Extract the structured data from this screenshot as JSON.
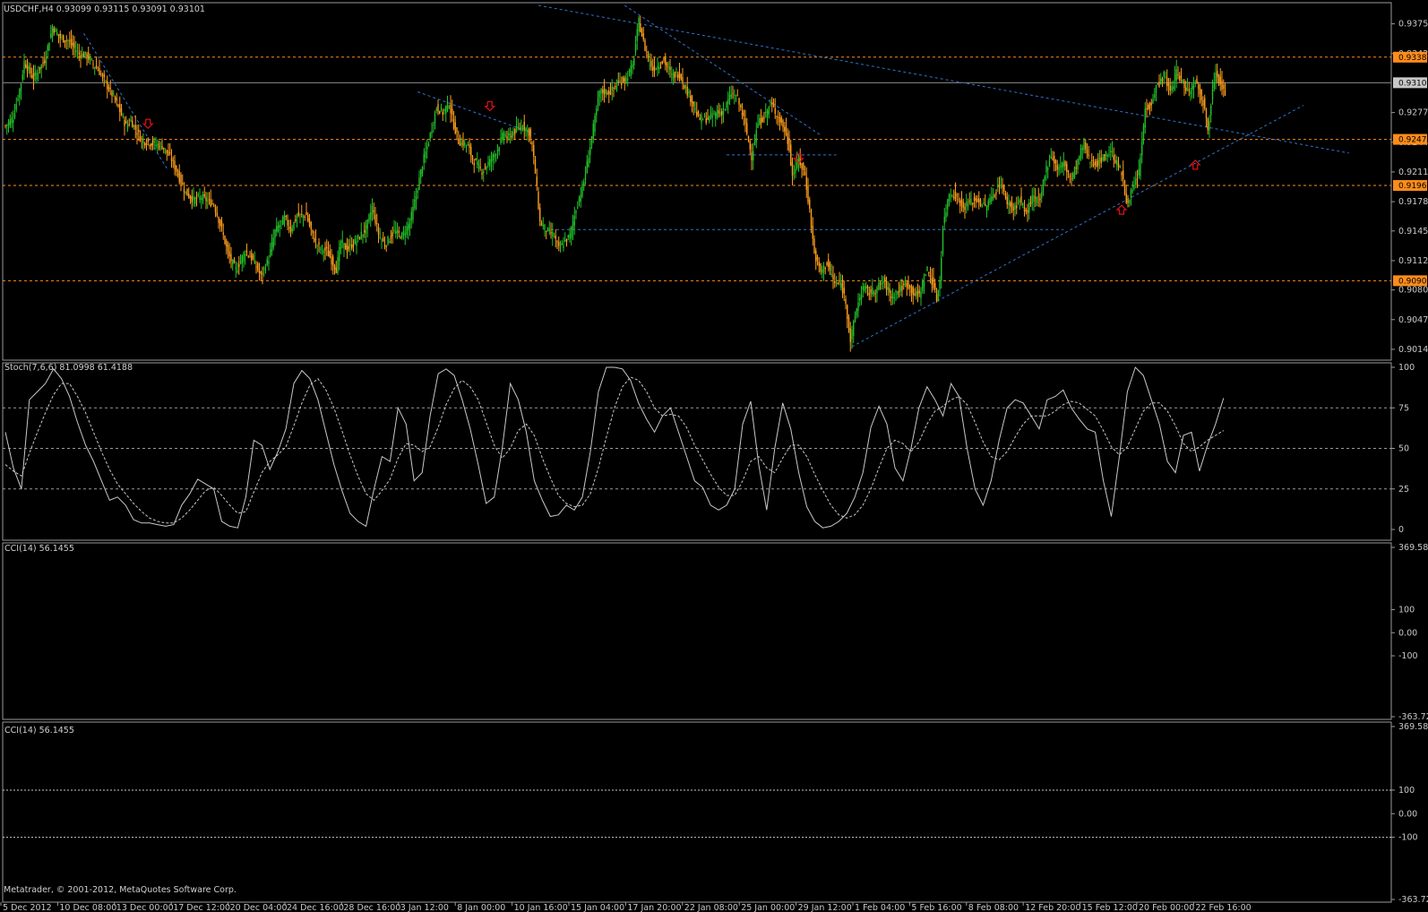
{
  "window": {
    "header": "USDCHF,H4  0.93099 0.93115 0.93091 0.93101",
    "copyright": "Metatrader, © 2001-2012, MetaQuotes Software Corp."
  },
  "colors": {
    "background": "#000000",
    "bull": "#22c22a",
    "bear": "#ff9e1c",
    "level_line": "#ff8c1a",
    "trendline": "#2f74d0",
    "arrow": "#e01010",
    "indicator": "#c8c8c8",
    "frame": "#9a9a9a"
  },
  "chart_data": [
    {
      "type": "candlestick",
      "title": "USDCHF,H4",
      "ohlc_header": [
        0.93099,
        0.93115,
        0.93091,
        0.93101
      ],
      "ylim": [
        0.9002,
        0.9399
      ],
      "y_tick_labels": [
        "0.93755",
        "0.93425",
        "0.92770",
        "0.92440",
        "0.92110",
        "0.91780",
        "0.91455",
        "0.91125",
        "0.90800",
        "0.90470",
        "0.90140"
      ],
      "y_ticks": [
        0.93755,
        0.93425,
        0.9277,
        0.9244,
        0.9211,
        0.9178,
        0.91455,
        0.91125,
        0.908,
        0.9047,
        0.9014
      ],
      "horizontal_levels": [
        {
          "label": "0.93385",
          "value": 0.93385
        },
        {
          "label": "0.92472",
          "value": 0.92472
        },
        {
          "label": "0.91960",
          "value": 0.9196
        },
        {
          "label": "0.90902",
          "value": 0.90902
        }
      ],
      "current_price": {
        "label": "0.93101",
        "value": 0.93101
      },
      "x_labels": [
        "5 Dec 2012",
        "10 Dec 08:00",
        "13 Dec 00:00",
        "17 Dec 12:00",
        "20 Dec 04:00",
        "24 Dec 16:00",
        "28 Dec 16:00",
        "3 Jan 12:00",
        "8 Jan 00:00",
        "10 Jan 16:00",
        "15 Jan 04:00",
        "17 Jan 20:00",
        "22 Jan 08:00",
        "25 Jan 00:00",
        "29 Jan 12:00",
        "1 Feb 04:00",
        "5 Feb 16:00",
        "8 Feb 08:00",
        "12 Feb 20:00",
        "15 Feb 12:00",
        "20 Feb 00:00",
        "22 Feb 16:00"
      ],
      "close_path": [
        [
          0,
          0.9262
        ],
        [
          5,
          0.9272
        ],
        [
          10,
          0.931
        ],
        [
          12,
          0.9333
        ],
        [
          18,
          0.9315
        ],
        [
          25,
          0.9335
        ],
        [
          30,
          0.9372
        ],
        [
          35,
          0.936
        ],
        [
          40,
          0.9357
        ],
        [
          47,
          0.9342
        ],
        [
          52,
          0.934
        ],
        [
          60,
          0.9322
        ],
        [
          70,
          0.9291
        ],
        [
          77,
          0.9262
        ],
        [
          80,
          0.9268
        ],
        [
          87,
          0.9246
        ],
        [
          95,
          0.9242
        ],
        [
          100,
          0.924
        ],
        [
          106,
          0.9225
        ],
        [
          112,
          0.92
        ],
        [
          115,
          0.9188
        ],
        [
          120,
          0.918
        ],
        [
          125,
          0.9183
        ],
        [
          133,
          0.9175
        ],
        [
          138,
          0.9147
        ],
        [
          142,
          0.912
        ],
        [
          147,
          0.9102
        ],
        [
          153,
          0.9123
        ],
        [
          158,
          0.9113
        ],
        [
          163,
          0.9095
        ],
        [
          168,
          0.9115
        ],
        [
          172,
          0.9145
        ],
        [
          178,
          0.916
        ],
        [
          182,
          0.9147
        ],
        [
          186,
          0.9162
        ],
        [
          192,
          0.9163
        ],
        [
          196,
          0.914
        ],
        [
          200,
          0.9127
        ],
        [
          205,
          0.9123
        ],
        [
          211,
          0.9103
        ],
        [
          214,
          0.9133
        ],
        [
          218,
          0.9125
        ],
        [
          223,
          0.9133
        ],
        [
          230,
          0.9148
        ],
        [
          234,
          0.9172
        ],
        [
          238,
          0.9142
        ],
        [
          242,
          0.913
        ],
        [
          248,
          0.9145
        ],
        [
          253,
          0.914
        ],
        [
          258,
          0.9155
        ],
        [
          262,
          0.9185
        ],
        [
          266,
          0.922
        ],
        [
          270,
          0.9245
        ],
        [
          275,
          0.9283
        ],
        [
          279,
          0.9277
        ],
        [
          283,
          0.9288
        ],
        [
          285,
          0.927
        ],
        [
          289,
          0.9245
        ],
        [
          295,
          0.924
        ],
        [
          298,
          0.9225
        ],
        [
          304,
          0.9212
        ],
        [
          310,
          0.9225
        ],
        [
          314,
          0.9237
        ],
        [
          318,
          0.9255
        ],
        [
          320,
          0.9248
        ],
        [
          324,
          0.9255
        ],
        [
          330,
          0.9263
        ],
        [
          334,
          0.9255
        ],
        [
          336,
          0.924
        ],
        [
          338,
          0.921
        ],
        [
          341,
          0.9155
        ],
        [
          346,
          0.9145
        ],
        [
          350,
          0.914
        ],
        [
          353,
          0.9125
        ],
        [
          356,
          0.9132
        ],
        [
          360,
          0.914
        ],
        [
          364,
          0.917
        ],
        [
          369,
          0.92
        ],
        [
          373,
          0.924
        ],
        [
          379,
          0.93
        ],
        [
          386,
          0.93
        ],
        [
          391,
          0.931
        ],
        [
          396,
          0.9315
        ],
        [
          400,
          0.9328
        ],
        [
          404,
          0.9378
        ],
        [
          408,
          0.9348
        ],
        [
          413,
          0.9325
        ],
        [
          420,
          0.9335
        ],
        [
          425,
          0.9318
        ],
        [
          430,
          0.932
        ],
        [
          435,
          0.93
        ],
        [
          438,
          0.929
        ],
        [
          442,
          0.927
        ],
        [
          448,
          0.927
        ],
        [
          454,
          0.9277
        ],
        [
          458,
          0.9278
        ],
        [
          463,
          0.9298
        ],
        [
          467,
          0.9292
        ],
        [
          471,
          0.927
        ],
        [
          474,
          0.9245
        ],
        [
          476,
          0.9228
        ],
        [
          480,
          0.9265
        ],
        [
          485,
          0.9275
        ],
        [
          488,
          0.9287
        ],
        [
          492,
          0.9275
        ],
        [
          497,
          0.9258
        ],
        [
          500,
          0.9238
        ],
        [
          502,
          0.9207
        ],
        [
          506,
          0.9225
        ],
        [
          510,
          0.9207
        ],
        [
          513,
          0.9168
        ],
        [
          516,
          0.912
        ],
        [
          520,
          0.91
        ],
        [
          524,
          0.911
        ],
        [
          529,
          0.9087
        ],
        [
          533,
          0.9087
        ],
        [
          536,
          0.9067
        ],
        [
          539,
          0.9023
        ],
        [
          543,
          0.906
        ],
        [
          547,
          0.9083
        ],
        [
          551,
          0.9077
        ],
        [
          555,
          0.908
        ],
        [
          560,
          0.909
        ],
        [
          565,
          0.9073
        ],
        [
          570,
          0.908
        ],
        [
          575,
          0.9087
        ],
        [
          580,
          0.9075
        ],
        [
          583,
          0.9075
        ],
        [
          585,
          0.9087
        ],
        [
          588,
          0.9103
        ],
        [
          591,
          0.909
        ],
        [
          594,
          0.907
        ],
        [
          596,
          0.909
        ],
        [
          598,
          0.915
        ],
        [
          602,
          0.9188
        ],
        [
          606,
          0.9185
        ],
        [
          611,
          0.9172
        ],
        [
          616,
          0.9178
        ],
        [
          620,
          0.918
        ],
        [
          625,
          0.9172
        ],
        [
          630,
          0.9185
        ],
        [
          635,
          0.92
        ],
        [
          638,
          0.918
        ],
        [
          643,
          0.917
        ],
        [
          647,
          0.918
        ],
        [
          651,
          0.9165
        ],
        [
          655,
          0.9182
        ],
        [
          660,
          0.9178
        ],
        [
          663,
          0.921
        ],
        [
          667,
          0.923
        ],
        [
          671,
          0.9215
        ],
        [
          675,
          0.922
        ],
        [
          680,
          0.9203
        ],
        [
          684,
          0.9223
        ],
        [
          688,
          0.9243
        ],
        [
          691,
          0.9225
        ],
        [
          696,
          0.922
        ],
        [
          701,
          0.9228
        ],
        [
          705,
          0.9235
        ],
        [
          709,
          0.922
        ],
        [
          712,
          0.921
        ],
        [
          715,
          0.9178
        ],
        [
          719,
          0.919
        ],
        [
          723,
          0.921
        ],
        [
          727,
          0.928
        ],
        [
          731,
          0.9288
        ],
        [
          734,
          0.9305
        ],
        [
          739,
          0.9318
        ],
        [
          743,
          0.93
        ],
        [
          747,
          0.9322
        ],
        [
          751,
          0.931
        ],
        [
          755,
          0.93
        ],
        [
          759,
          0.9313
        ],
        [
          762,
          0.93
        ],
        [
          765,
          0.9283
        ],
        [
          767,
          0.9255
        ],
        [
          770,
          0.9305
        ],
        [
          772,
          0.9325
        ],
        [
          775,
          0.931
        ],
        [
          778,
          0.9298
        ]
      ],
      "arrows": [
        {
          "type": "down",
          "x": 91,
          "price": 0.92645
        },
        {
          "type": "down",
          "x": 309,
          "price": 0.9284
        },
        {
          "type": "down",
          "x": 506,
          "price": 0.9226
        },
        {
          "type": "up",
          "x": 712,
          "price": 0.9169
        },
        {
          "type": "up",
          "x": 759,
          "price": 0.9219
        }
      ],
      "trendlines": [
        {
          "from": [
            50,
            0.9365
          ],
          "to": [
            103,
            0.9215
          ]
        },
        {
          "from": [
            263,
            0.93
          ],
          "to": [
            338,
            0.9253
          ]
        },
        {
          "from": [
            395,
            0.9396
          ],
          "to": [
            520,
            0.9252
          ]
        },
        {
          "from": [
            340,
            0.9396
          ],
          "to": [
            857,
            0.9232
          ]
        },
        {
          "from": [
            540,
            0.9017
          ],
          "to": [
            828,
            0.9285
          ]
        }
      ],
      "horizontal_segments": [
        {
          "from": [
            348,
            0.9147
          ],
          "to": [
            675,
            0.9147
          ]
        },
        {
          "from": [
            460,
            0.923
          ],
          "to": [
            530,
            0.923
          ]
        }
      ]
    },
    {
      "type": "line",
      "title": "Stoch(7,6,6)",
      "legend": "Stoch(7,6,6) 81.0998 61.4188",
      "ylim": [
        0,
        100
      ],
      "y_ticks": [
        100,
        75,
        50,
        25,
        0
      ],
      "levels": [
        75,
        50,
        25
      ],
      "series": [
        {
          "name": "Main",
          "values": [
            60,
            38,
            25,
            80,
            85,
            90,
            99,
            93,
            82,
            66,
            52,
            42,
            30,
            18,
            20,
            15,
            6,
            4,
            4,
            3,
            2,
            3,
            15,
            22,
            31,
            28,
            25,
            5,
            2,
            1,
            20,
            55,
            52,
            37,
            48,
            62,
            90,
            98,
            93,
            80,
            60,
            40,
            24,
            10,
            5,
            2,
            25,
            45,
            42,
            75,
            65,
            30,
            35,
            70,
            96,
            99,
            95,
            80,
            62,
            40,
            16,
            20,
            50,
            90,
            80,
            60,
            30,
            18,
            8,
            9,
            15,
            12,
            20,
            48,
            85,
            100,
            100,
            99,
            92,
            78,
            68,
            60,
            70,
            75,
            60,
            45,
            30,
            26,
            15,
            12,
            15,
            25,
            65,
            79,
            40,
            12,
            50,
            78,
            62,
            35,
            14,
            5,
            1,
            2,
            5,
            10,
            20,
            35,
            63,
            76,
            65,
            38,
            30,
            50,
            75,
            88,
            80,
            70,
            90,
            82,
            50,
            25,
            15,
            30,
            55,
            75,
            80,
            78,
            70,
            62,
            80,
            82,
            86,
            75,
            68,
            62,
            60,
            30,
            8,
            45,
            85,
            100,
            95,
            80,
            65,
            42,
            35,
            58,
            60,
            36,
            52,
            65,
            81
          ]
        },
        {
          "name": "Signal",
          "values": [
            40,
            36,
            33,
            47,
            60,
            72,
            83,
            90,
            90,
            82,
            72,
            60,
            48,
            37,
            28,
            22,
            16,
            11,
            7,
            5,
            4,
            4,
            7,
            12,
            18,
            24,
            26,
            21,
            15,
            10,
            11,
            23,
            35,
            42,
            46,
            51,
            64,
            78,
            89,
            93,
            86,
            75,
            61,
            46,
            33,
            22,
            18,
            24,
            31,
            44,
            53,
            52,
            48,
            51,
            63,
            77,
            87,
            92,
            88,
            80,
            66,
            52,
            44,
            50,
            61,
            65,
            58,
            44,
            32,
            21,
            16,
            14,
            15,
            22,
            38,
            57,
            75,
            88,
            94,
            92,
            85,
            75,
            70,
            71,
            70,
            63,
            52,
            43,
            34,
            26,
            21,
            21,
            30,
            42,
            45,
            38,
            35,
            44,
            52,
            52,
            45,
            34,
            24,
            15,
            9,
            7,
            9,
            15,
            25,
            38,
            50,
            55,
            53,
            48,
            54,
            65,
            73,
            76,
            80,
            82,
            77,
            66,
            54,
            45,
            43,
            48,
            57,
            65,
            70,
            70,
            70,
            73,
            77,
            79,
            78,
            74,
            70,
            61,
            51,
            46,
            51,
            62,
            73,
            78,
            78,
            73,
            64,
            53,
            48,
            51,
            55,
            58,
            61
          ]
        }
      ]
    },
    {
      "type": "line",
      "title": "CCI(14)",
      "legend": "CCI(14) 56.1455",
      "ylim": [
        -363.7279,
        369.5866
      ],
      "y_tick_labels": [
        "369.5866",
        "100",
        "0.00",
        "-100",
        "-363.7279"
      ],
      "y_ticks": [
        369.5866,
        100,
        0,
        -100,
        -363.7279
      ],
      "levels": [],
      "series": []
    },
    {
      "type": "line",
      "title": "CCI(14)",
      "legend": "CCI(14) 56.1455",
      "ylim": [
        -363.7279,
        369.5866
      ],
      "y_tick_labels": [
        "369.5866",
        "100",
        "0.00",
        "-100",
        "-363.7279"
      ],
      "y_ticks": [
        369.5866,
        100,
        0,
        -100,
        -363.7279
      ],
      "levels": [
        100,
        -100
      ],
      "series": []
    }
  ]
}
